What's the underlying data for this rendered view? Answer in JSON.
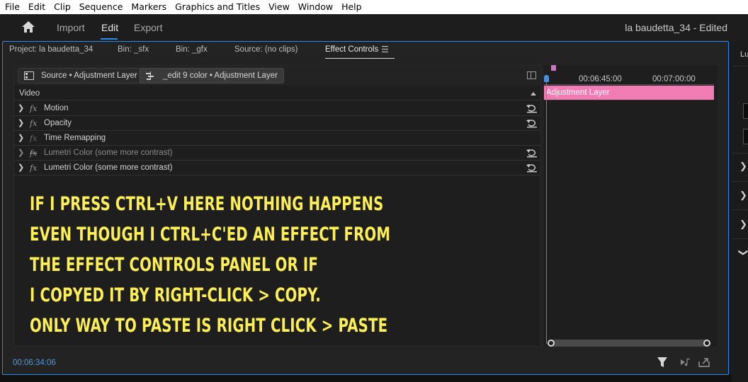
{
  "menu": [
    "File",
    "Edit",
    "Clip",
    "Sequence",
    "Markers",
    "Graphics and Titles",
    "View",
    "Window",
    "Help"
  ],
  "header": {
    "workspaces": [
      "Import",
      "Edit",
      "Export"
    ],
    "active_workspace": "Edit",
    "document_title": "la baudetta_34 - Edited"
  },
  "panel": {
    "tabs": [
      "Project: la baudetta_34",
      "Bin: _sfx",
      "Bin: _gfx",
      "Source: (no clips)",
      "Effect Controls"
    ],
    "active_tab": "Effect Controls",
    "source_label": "Source • Adjustment Layer",
    "sequence_label": "_edit 9 color • Adjustment Layer",
    "video_header": "Video",
    "effects": [
      {
        "name": "Motion",
        "disabled": false,
        "reset": true
      },
      {
        "name": "Opacity",
        "disabled": false,
        "reset": true
      },
      {
        "name": "Time Remapping",
        "disabled": false,
        "reset": false
      },
      {
        "name": "Lumetri Color (some more contrast)",
        "disabled": true,
        "reset": true
      },
      {
        "name": "Lumetri Color (some more contrast)",
        "disabled": false,
        "reset": true
      }
    ],
    "fx_symbol": "fx",
    "timeline": {
      "ticks": [
        "00:06:45:00",
        "00:07:00:00"
      ],
      "clip_name": "Adjustment Layer"
    },
    "timecode": "00:06:34:06"
  },
  "annotation": [
    "IF I PRESS CTRL+V HERE NOTHING HAPPENS",
    "EVEN THOUGH I CTRL+C'ED AN EFFECT FROM",
    "THE EFFECT CONTROLS PANEL OR IF",
    "I COPYED IT BY RIGHT-CLICK > COPY.",
    "ONLY WAY TO PASTE IS RIGHT CLICK > PASTE"
  ],
  "right_panel": {
    "title": "Lu"
  },
  "colors": {
    "accent": "#2d8ceb",
    "clip": "#f07cb3",
    "annotation": "#fbee57",
    "timecode": "#4b9be8"
  }
}
